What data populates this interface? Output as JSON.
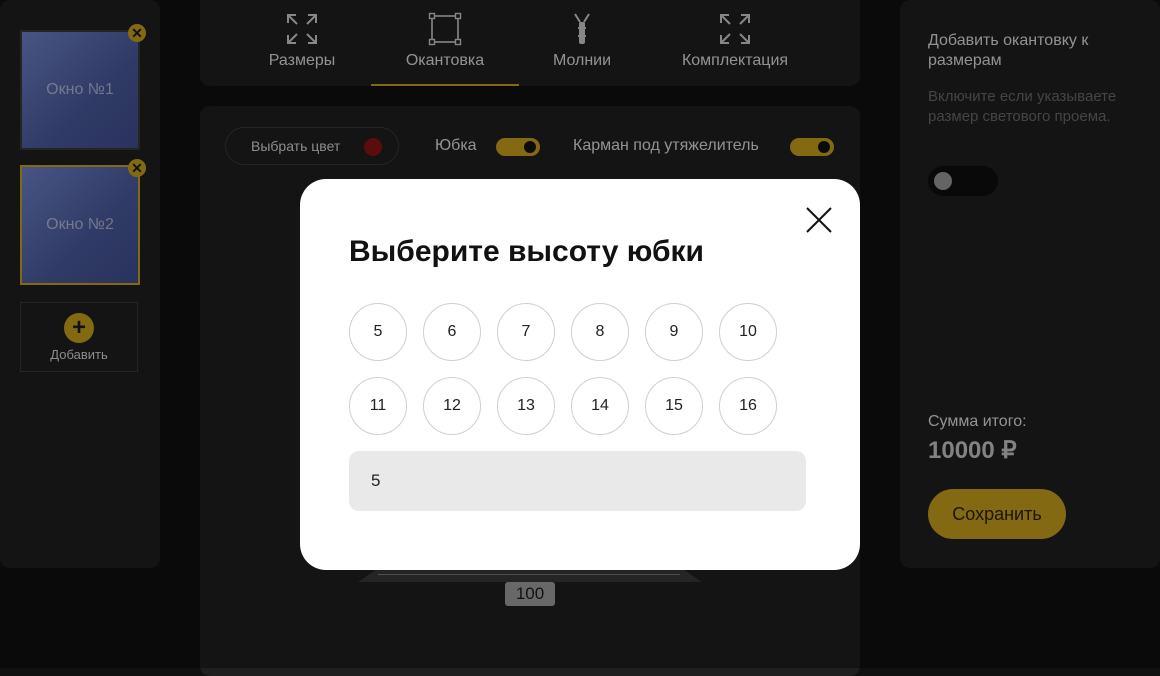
{
  "sidebar": {
    "windows": [
      {
        "label": "Окно №1",
        "active": false
      },
      {
        "label": "Окно №2",
        "active": true
      }
    ],
    "close_glyph": "✕",
    "add_icon": "plus-icon",
    "add_label": "Добавить"
  },
  "tabs": [
    {
      "label": "Размеры",
      "icon": "expand-arrows-icon",
      "active": false
    },
    {
      "label": "Окантовка",
      "icon": "frame-square-icon",
      "active": true
    },
    {
      "label": "Молнии",
      "icon": "zipper-icon",
      "active": false
    },
    {
      "label": "Комплектация",
      "icon": "expand-arrows-icon",
      "active": false
    }
  ],
  "main": {
    "color_button_label": "Выбрать цвет",
    "color_swatch": "#8d1414",
    "skirt_toggle_label": "Юбка",
    "skirt_toggle_on": true,
    "pocket_toggle_label": "Карман под утяжелитель",
    "pocket_toggle_on": true,
    "dimension_label": "100"
  },
  "right_panel": {
    "title": "Добавить окантовку к размерам",
    "description": "Включите если указываете размер светового проема.",
    "toggle_on": false,
    "total_label": "Сумма итого:",
    "total_value": "10000 ₽",
    "save_label": "Сохранить"
  },
  "modal": {
    "title": "Выберите высоту юбки",
    "options_row1": [
      "5",
      "6",
      "7",
      "8",
      "9",
      "10"
    ],
    "options_row2": [
      "11",
      "12",
      "13",
      "14",
      "15",
      "16"
    ],
    "input_value": "5"
  },
  "colors": {
    "accent": "#c9a21c",
    "background": "#101010",
    "panel": "#1f1f1f"
  }
}
